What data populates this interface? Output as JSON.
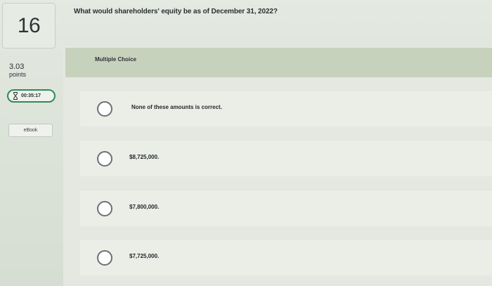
{
  "question": {
    "number": "16",
    "points_value": "3.03",
    "points_label": "points",
    "timer": "00:35:17",
    "ebook_label": "eBook",
    "text": "What would shareholders' equity be as of December 31, 2022?"
  },
  "choices": {
    "header": "Multiple Choice",
    "options": [
      {
        "label": "None of these amounts is correct."
      },
      {
        "label": "$8,725,000."
      },
      {
        "label": "$7,800,000."
      },
      {
        "label": "$7,725,000."
      }
    ]
  },
  "colors": {
    "timer_border": "#2f8a55",
    "header_band": "#c7d2bd",
    "option_bg": "#eaeee7"
  },
  "icons": {
    "timer": "hourglass-icon",
    "radio": "radio-button-icon"
  }
}
